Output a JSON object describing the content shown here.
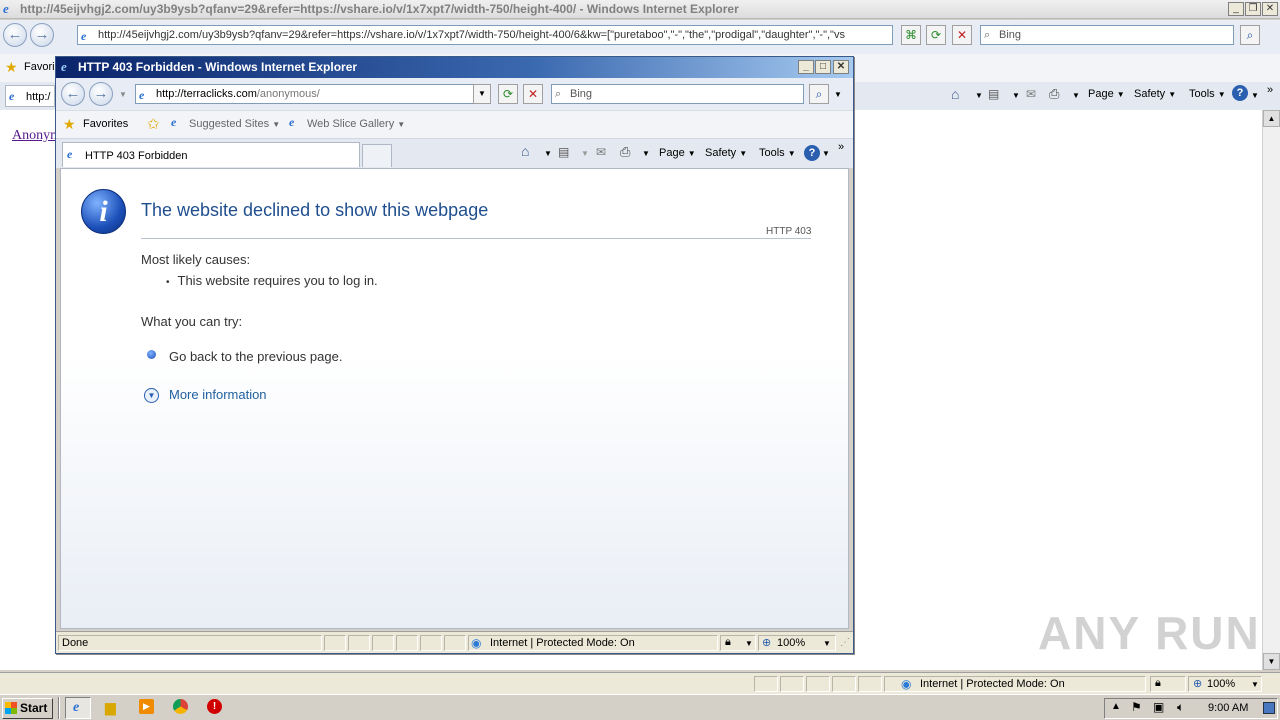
{
  "bg_window": {
    "title": "http://45eijvhgj2.com/uy3b9ysb?qfanv=29&refer=https://vshare.io/v/1x7xpt7/width-750/height-400/ - Windows Internet Explorer",
    "address": "http://45eijvhgj2.com/uy3b9ysb?qfanv=29&refer=https://vshare.io/v/1x7xpt7/width-750/height-400/6&kw=[\"puretaboo\",\"-\",\"the\",\"prodigal\",\"daughter\",\"-\",\"vs",
    "search_placeholder": "Bing",
    "favorites_label": "Favori",
    "tab_label": "http:/",
    "cmd": {
      "page": "Page",
      "safety": "Safety",
      "tools": "Tools"
    },
    "page_link": "Anonym",
    "status_zone": "Internet | Protected Mode: On",
    "zoom": "100%"
  },
  "popup": {
    "title": "HTTP 403 Forbidden - Windows Internet Explorer",
    "address_domain": "http://terraclicks.com",
    "address_path": "/anonymous/",
    "search_placeholder": "Bing",
    "favorites_label": "Favorites",
    "suggested_sites": "Suggested Sites",
    "web_slice_gallery": "Web Slice Gallery",
    "tab_label": "HTTP 403 Forbidden",
    "cmd": {
      "page": "Page",
      "safety": "Safety",
      "tools": "Tools"
    },
    "content": {
      "heading": "The website declined to show this webpage",
      "code": "HTTP 403",
      "causes_label": "Most likely causes:",
      "cause_1": "This website requires you to log in.",
      "try_label": "What you can try:",
      "try_1": "Go back to the previous page.",
      "more_info": "More information"
    },
    "status_text": "Done",
    "status_zone": "Internet | Protected Mode: On",
    "zoom": "100%"
  },
  "taskbar": {
    "start": "Start",
    "clock": "9:00 AM"
  },
  "watermark": "ANY RUN",
  "colors": {
    "heading": "#1f4f8f",
    "link": "#1f5f9f",
    "titlebar": "#0a246a"
  }
}
